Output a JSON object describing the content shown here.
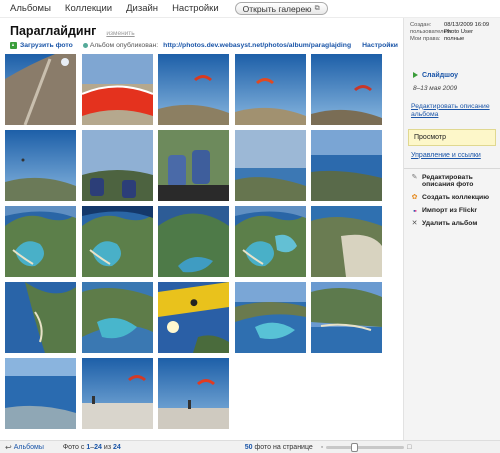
{
  "nav": {
    "items": [
      "Альбомы",
      "Коллекции",
      "Дизайн",
      "Настройки"
    ],
    "gallery_button": "Открыть галерею"
  },
  "album": {
    "title": "Параглайдинг",
    "title_edit": "изменить",
    "upload_label": "Загрузить фото",
    "published_label": "Альбом опубликован:",
    "url": "http://photos.dev.webasyst.net/photos/album/paraglajding",
    "settings_label": "Настройки"
  },
  "meta": {
    "created_label": "Создан:",
    "created_value": "08/13/2009 16:09",
    "user_label": "пользователем:",
    "user_value": "Photo User",
    "rights_label": "Мои права:",
    "rights_value": "полные"
  },
  "sidebar": {
    "slideshow": "Слайдшоу",
    "date_range": "8–13 мая 2009",
    "edit_description": "Редактировать описание альбома",
    "view": "Просмотр",
    "manage_links": "Управление и ссылки",
    "actions": [
      {
        "label": "Редактировать описания фото",
        "icon": "pencil-icon",
        "symbol": "✎",
        "color": "#777777"
      },
      {
        "label": "Создать коллекцию",
        "icon": "collection-icon",
        "symbol": "✿",
        "color": "#e58a1f"
      },
      {
        "label": "Импорт из Flickr",
        "icon": "flickr-icon",
        "symbol": "●●",
        "color": "#1a55a8"
      },
      {
        "label": "Удалить альбом",
        "icon": "delete-icon",
        "symbol": "✕",
        "color": "#555555"
      }
    ]
  },
  "pager": {
    "back_label": "Альбомы",
    "photos_label": "Фото с",
    "from": "1",
    "dash": "–",
    "to": "24",
    "of_label": "из",
    "total": "24",
    "per_page": "50",
    "per_page_label": "фото на странице",
    "thumb_size_fraction": 0.35
  },
  "photos": [
    {
      "scene": "cliff"
    },
    {
      "scene": "wing"
    },
    {
      "scene": "para-red-a"
    },
    {
      "scene": "para-red-b"
    },
    {
      "scene": "para-tiny"
    },
    {
      "scene": "sky-hill"
    },
    {
      "scene": "feet-a"
    },
    {
      "scene": "feet-b"
    },
    {
      "scene": "coast-haze"
    },
    {
      "scene": "coast-blue"
    },
    {
      "scene": "lagoon-a"
    },
    {
      "scene": "lagoon-b"
    },
    {
      "scene": "fisheye-a"
    },
    {
      "scene": "lagoon-c"
    },
    {
      "scene": "town"
    },
    {
      "scene": "lagoon-d"
    },
    {
      "scene": "lagoon-e"
    },
    {
      "scene": "sun-wing"
    },
    {
      "scene": "lagoon-f"
    },
    {
      "scene": "beach"
    },
    {
      "scene": "sea-view"
    },
    {
      "scene": "ground-para"
    },
    {
      "scene": "ground-red"
    }
  ]
}
